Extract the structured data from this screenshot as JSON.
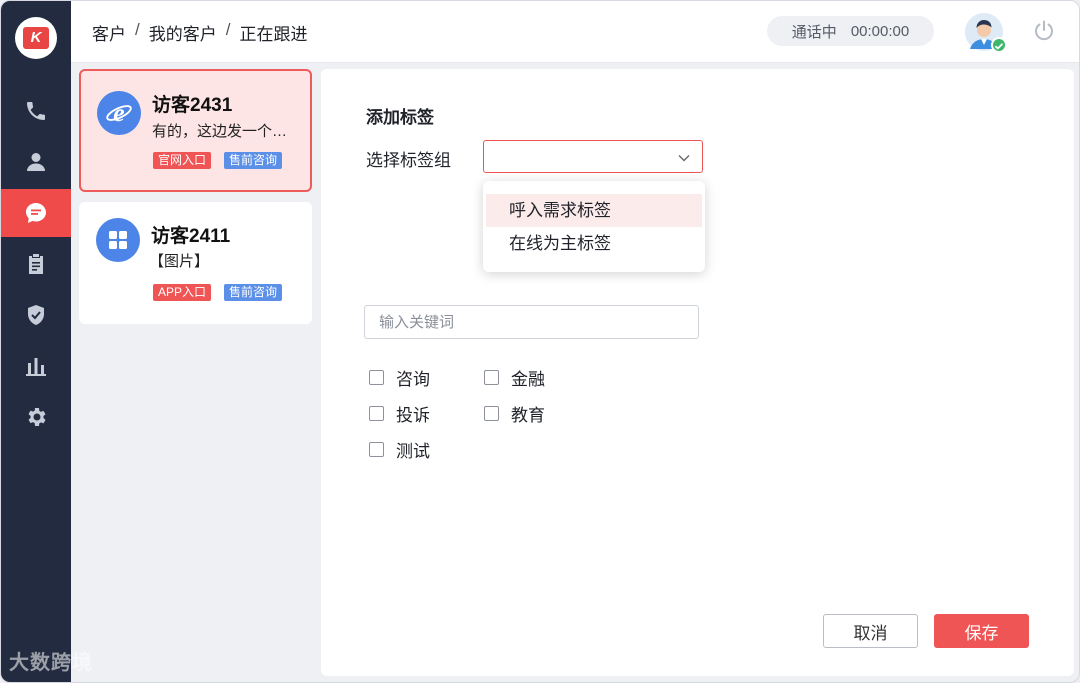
{
  "sidebar": {
    "logo_text": "K",
    "items": [
      {
        "icon": "phone-icon",
        "active": false
      },
      {
        "icon": "user-icon",
        "active": false
      },
      {
        "icon": "chat-icon",
        "active": true
      },
      {
        "icon": "clipboard-icon",
        "active": false
      },
      {
        "icon": "shield-check-icon",
        "active": false
      },
      {
        "icon": "bar-chart-icon",
        "active": false
      },
      {
        "icon": "gear-icon",
        "active": false
      }
    ],
    "watermark": "大数跨境"
  },
  "header": {
    "breadcrumb": [
      "客户",
      "我的客户",
      "正在跟进"
    ],
    "separator": "/",
    "call_status_label": "通话中",
    "call_timer": "00:00:00"
  },
  "conversations": [
    {
      "name": "访客2431",
      "message": "有的，这边发一个…",
      "icon": "ie-browser-icon",
      "tags": [
        {
          "label": "官网入口",
          "color": "red"
        },
        {
          "label": "售前咨询",
          "color": "blue"
        }
      ],
      "active": true
    },
    {
      "name": "访客2411",
      "message": "【图片】",
      "icon": "app-grid-icon",
      "tags": [
        {
          "label": "APP入口",
          "color": "red"
        },
        {
          "label": "售前咨询",
          "color": "blue"
        }
      ],
      "active": false
    }
  ],
  "form": {
    "title": "添加标签",
    "select_label": "选择标签组",
    "select_value": "",
    "dropdown_options": [
      "呼入需求标签",
      "在线为主标签"
    ],
    "search_placeholder": "输入关键词",
    "checkboxes": [
      {
        "label": "咨询",
        "checked": false
      },
      {
        "label": "金融",
        "checked": false
      },
      {
        "label": "投诉",
        "checked": false
      },
      {
        "label": "教育",
        "checked": false
      },
      {
        "label": "测试",
        "checked": false
      }
    ],
    "cancel_label": "取消",
    "save_label": "保存"
  },
  "colors": {
    "accent": "#ef5555",
    "sidebar": "#222b3f",
    "blue_tag": "#5b8fe8"
  }
}
